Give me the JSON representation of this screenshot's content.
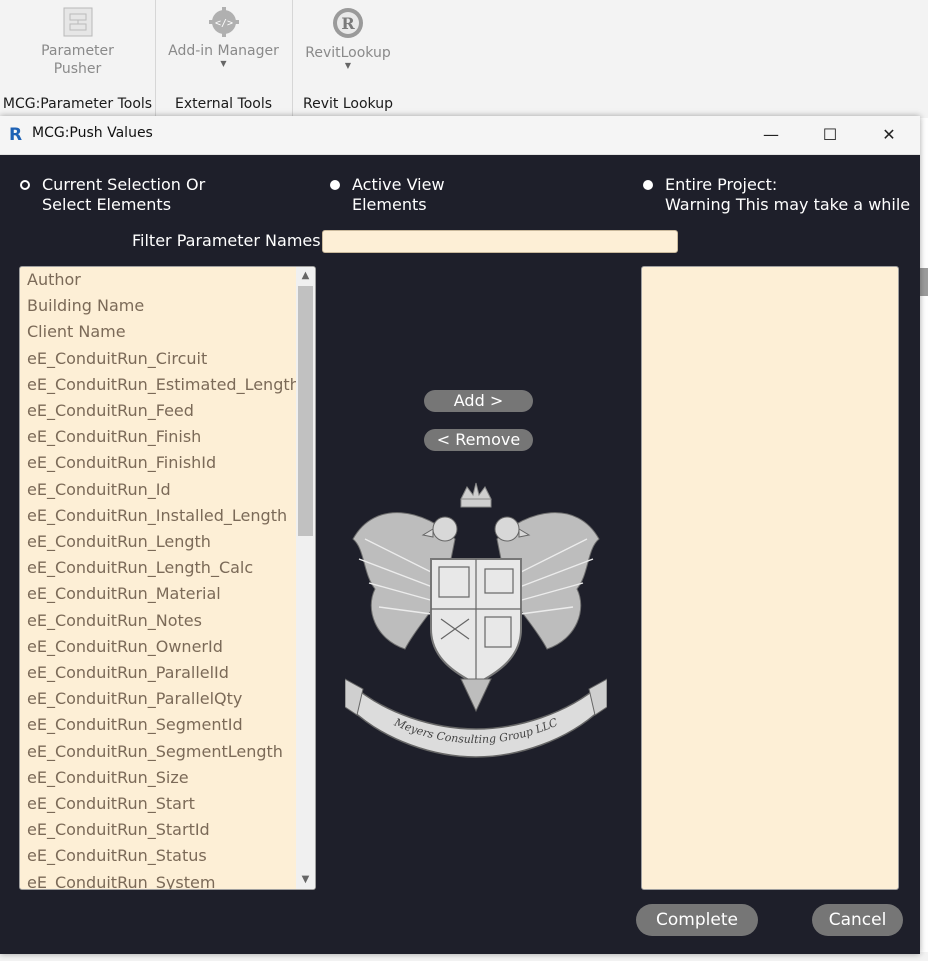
{
  "ribbon": {
    "panels": [
      {
        "button_line1": "Parameter",
        "button_line2": "Pusher",
        "title": "MCG:Parameter Tools",
        "icon": "parameter-pusher-icon"
      },
      {
        "button_line1": "Add-in Manager",
        "title": "External Tools",
        "icon": "addin-manager-icon"
      },
      {
        "button_line1": "RevitLookup",
        "title": "Revit Lookup",
        "icon": "revitlookup-icon"
      }
    ]
  },
  "dialog": {
    "title": "MCG:Push Values",
    "app_icon_letter": "R",
    "minimize": "—",
    "maximize": "☐",
    "close": "✕",
    "scopes": [
      {
        "line1": "Current Selection Or",
        "line2": "Select Elements",
        "selected": true
      },
      {
        "line1": "Active View",
        "line2": "Elements",
        "selected": false
      },
      {
        "line1": "Entire Project:",
        "line2": "Warning This may take a while",
        "selected": false
      }
    ],
    "filter_label": "Filter Parameter Names:",
    "filter_value": "",
    "parameters": [
      "Author",
      "Building Name",
      "Client Name",
      "eE_ConduitRun_Circuit",
      "eE_ConduitRun_Estimated_Length",
      "eE_ConduitRun_Feed",
      "eE_ConduitRun_Finish",
      "eE_ConduitRun_FinishId",
      "eE_ConduitRun_Id",
      "eE_ConduitRun_Installed_Length",
      "eE_ConduitRun_Length",
      "eE_ConduitRun_Length_Calc",
      "eE_ConduitRun_Material",
      "eE_ConduitRun_Notes",
      "eE_ConduitRun_OwnerId",
      "eE_ConduitRun_ParallelId",
      "eE_ConduitRun_ParallelQty",
      "eE_ConduitRun_SegmentId",
      "eE_ConduitRun_SegmentLength",
      "eE_ConduitRun_Size",
      "eE_ConduitRun_Start",
      "eE_ConduitRun_StartId",
      "eE_ConduitRun_Status",
      "eE_ConduitRun_System"
    ],
    "add_label": "Add >",
    "remove_label": "< Remove",
    "logo_text": "Meyers Consulting Group LLC",
    "complete_label": "Complete",
    "cancel_label": "Cancel"
  },
  "colors": {
    "dialog_bg": "#1e1f2a",
    "list_bg": "#fdefd6",
    "list_text": "#7b6a58",
    "button_bg": "#767676"
  }
}
